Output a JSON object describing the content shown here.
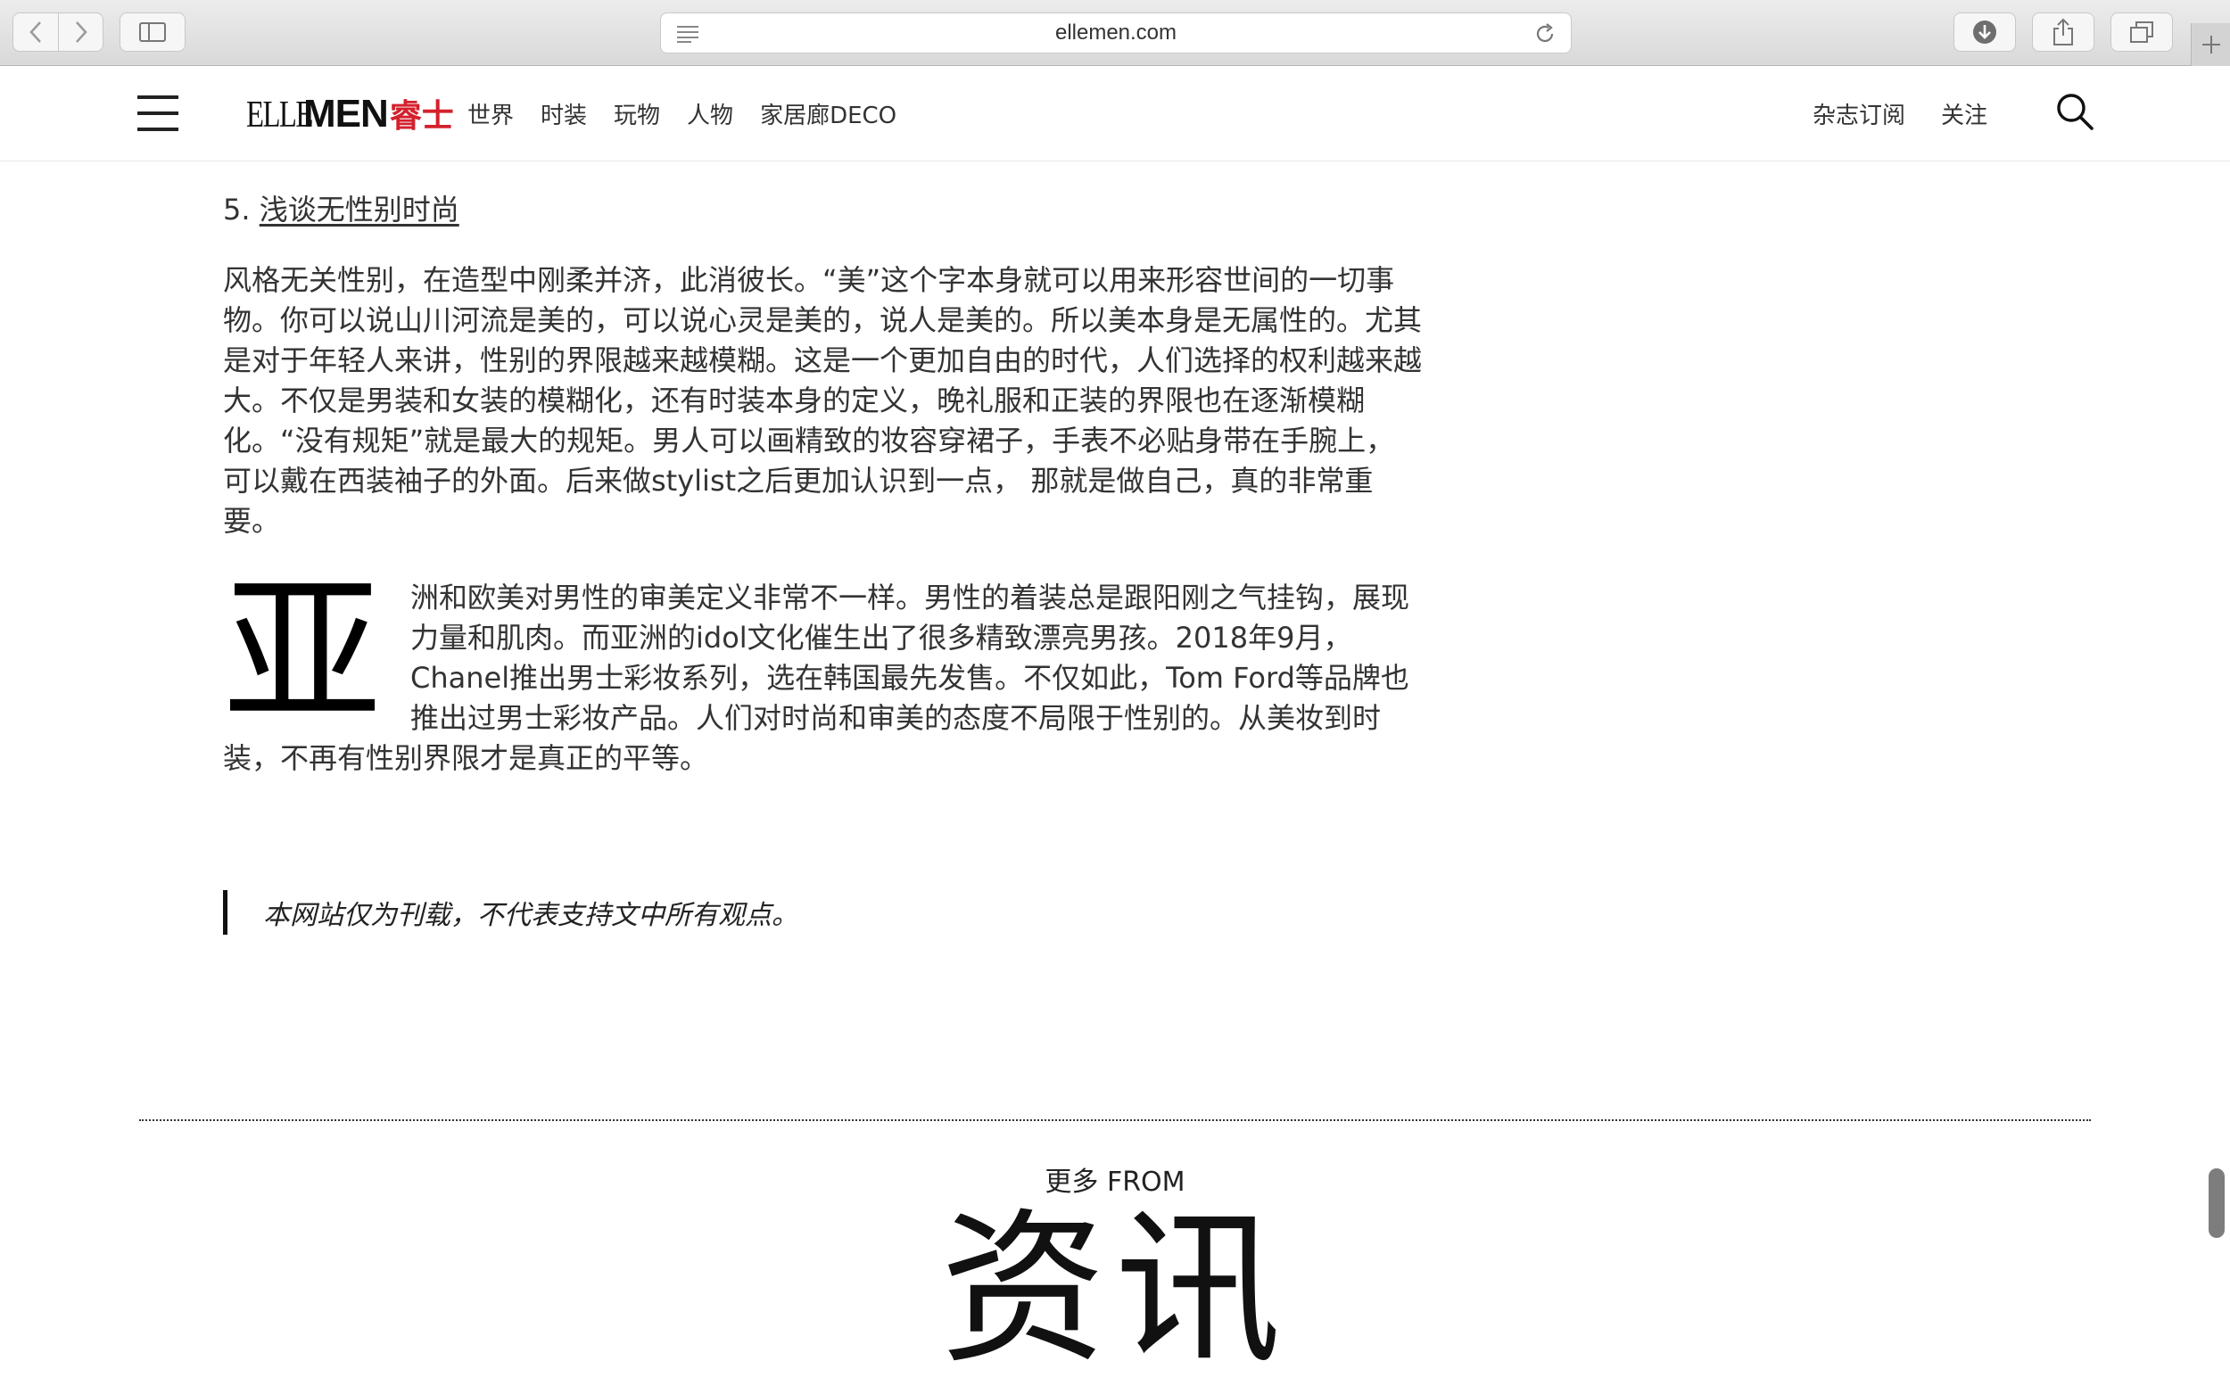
{
  "browser": {
    "url": "ellemen.com",
    "icons": {
      "back": "chevron-left-icon",
      "forward": "chevron-right-icon",
      "sidebar": "sidebar-icon",
      "reader": "reader-icon",
      "reload": "reload-icon",
      "downloads": "download-icon",
      "share": "share-icon",
      "tabs": "tabs-icon",
      "new_tab": "plus-icon"
    }
  },
  "header": {
    "logo": {
      "elle": "ELLE",
      "men": "MEN",
      "zh": "睿士"
    },
    "nav": [
      "世界",
      "时装",
      "玩物",
      "人物",
      "家居廊DECO"
    ],
    "utility": [
      "杂志订阅",
      "关注"
    ],
    "colors": {
      "brand_red": "#d4202d"
    }
  },
  "article": {
    "list_item": {
      "number": "5. ",
      "link_text": "浅谈无性别时尚"
    },
    "paragraph_1": "风格无关性别，在造型中刚柔并济，此消彼长。“美”这个字本身就可以用来形容世间的一切事物。你可以说山川河流是美的，可以说心灵是美的，说人是美的。所以美本身是无属性的。尤其是对于年轻人来讲，性别的界限越来越模糊。这是一个更加自由的时代，人们选择的权利越来越大。不仅是男装和女装的模糊化，还有时装本身的定义，晚礼服和正装的界限也在逐渐模糊化。“没有规矩”就是最大的规矩。男人可以画精致的妆容穿裙子，手表不必贴身带在手腕上，可以戴在西装袖子的外面。后来做stylist之后更加认识到一点， 那就是做自己，真的非常重要。",
    "dropcap": "亚",
    "paragraph_2": "洲和欧美对男性的审美定义非常不一样。男性的着装总是跟阳刚之气挂钩，展现力量和肌肉。而亚洲的idol文化催生出了很多精致漂亮男孩。2018年9月，Chanel推出男士彩妆系列，选在韩国最先发售。不仅如此，Tom Ford等品牌也推出过男士彩妆产品。人们对时尚和审美的态度不局限于性别的。从美妆到时装，不再有性别界限才是真正的平等。",
    "disclaimer": "本网站仅为刊载，不代表支持文中所有观点。"
  },
  "more": {
    "label": "更多 FROM",
    "title": "资讯"
  }
}
